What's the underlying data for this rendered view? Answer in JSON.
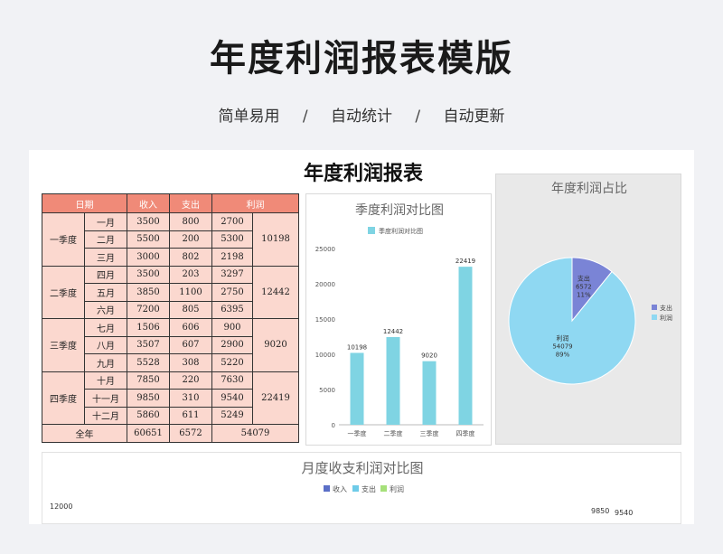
{
  "header": {
    "title": "年度利润报表模版",
    "subtitle_items": [
      "简单易用",
      "自动统计",
      "自动更新"
    ],
    "separator": "/"
  },
  "report": {
    "title": "年度利润报表",
    "columns": [
      "日期",
      "收入",
      "支出",
      "利润"
    ],
    "quarters": [
      {
        "name": "一季度",
        "total": "10198",
        "months": [
          {
            "month": "一月",
            "income": "3500",
            "expense": "800",
            "profit": "2700"
          },
          {
            "month": "二月",
            "income": "5500",
            "expense": "200",
            "profit": "5300"
          },
          {
            "month": "三月",
            "income": "3000",
            "expense": "802",
            "profit": "2198"
          }
        ]
      },
      {
        "name": "二季度",
        "total": "12442",
        "months": [
          {
            "month": "四月",
            "income": "3500",
            "expense": "203",
            "profit": "3297"
          },
          {
            "month": "五月",
            "income": "3850",
            "expense": "1100",
            "profit": "2750"
          },
          {
            "month": "六月",
            "income": "7200",
            "expense": "805",
            "profit": "6395"
          }
        ]
      },
      {
        "name": "三季度",
        "total": "9020",
        "months": [
          {
            "month": "七月",
            "income": "1506",
            "expense": "606",
            "profit": "900"
          },
          {
            "month": "八月",
            "income": "3507",
            "expense": "607",
            "profit": "2900"
          },
          {
            "month": "九月",
            "income": "5528",
            "expense": "308",
            "profit": "5220"
          }
        ]
      },
      {
        "name": "四季度",
        "total": "22419",
        "months": [
          {
            "month": "十月",
            "income": "7850",
            "expense": "220",
            "profit": "7630"
          },
          {
            "month": "十一月",
            "income": "9850",
            "expense": "310",
            "profit": "9540"
          },
          {
            "month": "十二月",
            "income": "5860",
            "expense": "611",
            "profit": "5249"
          }
        ]
      }
    ],
    "annual": {
      "label": "全年",
      "income": "60651",
      "expense": "6572",
      "profit": "54079"
    }
  },
  "colors": {
    "header_fill": "#f08a78",
    "cell_fill": "#fbd8cf",
    "bar": "#7fd4e3",
    "pie_expense": "#7a84d6",
    "pie_profit": "#8fd8f2",
    "income_legend": "#5b6fc7",
    "expense_legend": "#6ecbe8",
    "profit_legend": "#a6e07a"
  },
  "chart_data": [
    {
      "type": "bar",
      "title": "季度利润对比图",
      "legend": [
        "季度利润对比图"
      ],
      "categories": [
        "一季度",
        "二季度",
        "三季度",
        "四季度"
      ],
      "values": [
        10198,
        12442,
        9020,
        22419
      ],
      "ylim": [
        0,
        25000
      ],
      "yticks": [
        "0",
        "5000",
        "10000",
        "15000",
        "20000",
        "25000"
      ]
    },
    {
      "type": "pie",
      "title": "年度利润占比",
      "slices": [
        {
          "name": "支出",
          "value": 6572,
          "percent": "11%"
        },
        {
          "name": "利润",
          "value": 54079,
          "percent": "89%"
        }
      ],
      "legend": [
        "支出",
        "利润"
      ]
    },
    {
      "type": "bar",
      "title": "月度收支利润对比图",
      "legend": [
        "收入",
        "支出",
        "利润"
      ],
      "ytick_top": "12000",
      "visible_labels": [
        "9850",
        "9540"
      ]
    }
  ]
}
